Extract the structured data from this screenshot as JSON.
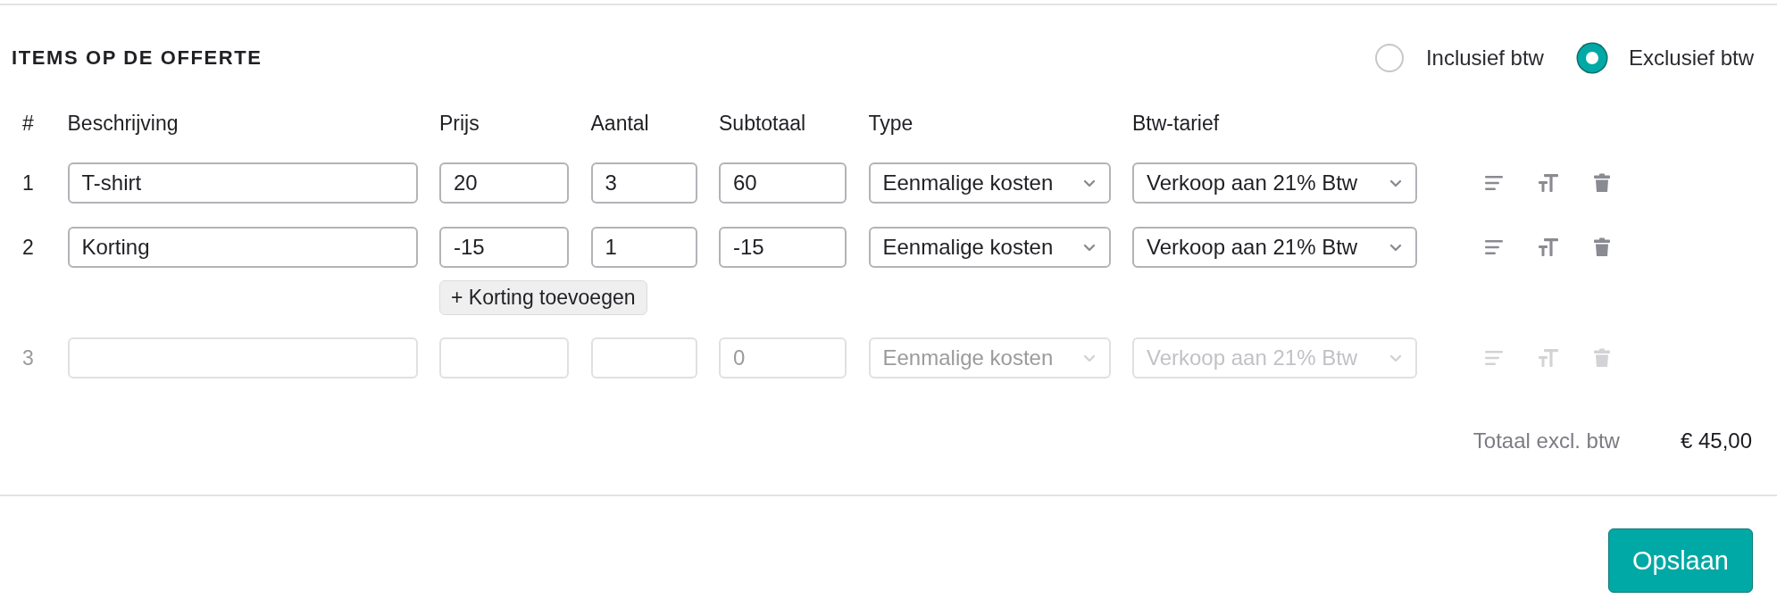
{
  "section": {
    "title": "ITEMS OP DE OFFERTE"
  },
  "vat_mode": [
    {
      "label": "Inclusief btw",
      "selected": false
    },
    {
      "label": "Exclusief btw",
      "selected": true
    }
  ],
  "table": {
    "columns": [
      "#",
      "Beschrijving",
      "Prijs",
      "Aantal",
      "Subtotaal",
      "Type",
      "Btw-tarief"
    ],
    "rows": [
      {
        "number": "1",
        "description": "T-shirt",
        "price": "20",
        "quantity": "3",
        "subtotal": "60",
        "type": "Eenmalige kosten",
        "vat_rate": "Verkoop aan 21% Btw",
        "disabled": false
      },
      {
        "number": "2",
        "description": "Korting",
        "price": "-15",
        "quantity": "1",
        "subtotal": "-15",
        "type": "Eenmalige kosten",
        "vat_rate": "Verkoop aan 21% Btw",
        "disabled": false,
        "action_button": "+ Korting toevoegen"
      },
      {
        "number": "3",
        "subtotal": "0",
        "type": "Eenmalige kosten",
        "vat_rate": "Verkoop aan 21% Btw",
        "disabled": true
      }
    ]
  },
  "total": {
    "label": "Totaal excl. btw",
    "value": "€ 45,00"
  },
  "buttons": [
    "Opslaan"
  ]
}
